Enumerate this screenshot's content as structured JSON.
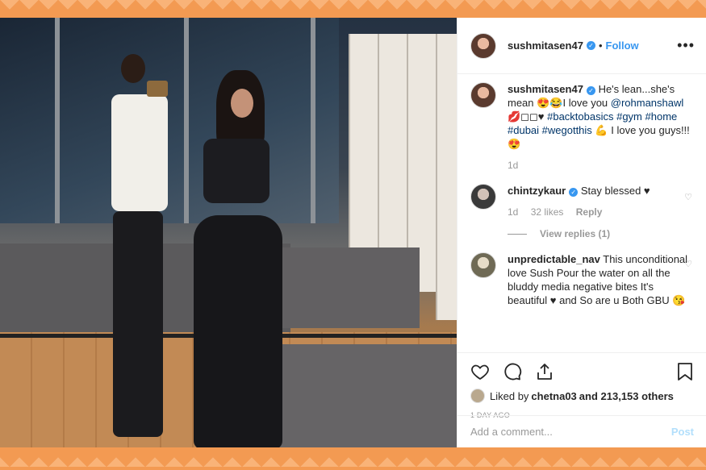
{
  "post": {
    "username": "sushmitasen47",
    "follow_label": "Follow",
    "separator": "•",
    "more_label": "•••"
  },
  "caption": {
    "username": "sushmitasen47",
    "text_start": "He's lean...she's mean 😍😂I love you ",
    "mention": "@rohmanshawl",
    "text_mid": " 💋◻◻♥ ",
    "hashtags": "#backtobasics #gym #home #dubai #wegotthis",
    "text_end": " 💪 I love you guys!!!😍",
    "time": "1d"
  },
  "comments": [
    {
      "username": "chintzykaur",
      "text": "Stay blessed ♥",
      "time": "1d",
      "likes": "32 likes",
      "reply_label": "Reply",
      "view_replies": "View replies (1)"
    },
    {
      "username": "unpredictable_nav",
      "text": "This unconditional love Sush Pour the water on all the bluddy media negative bites It's beautiful ♥ and So are u Both GBU 😘"
    }
  ],
  "likes_line": {
    "prefix": "Liked by ",
    "user": "chetna03",
    "suffix": " and 213,153 others"
  },
  "time_ago": "1 DAY AGO",
  "add_comment": {
    "placeholder": "Add a comment...",
    "post_label": "Post"
  },
  "colors": {
    "accent": "#3897f0",
    "background_frame": "#f6a25d"
  }
}
